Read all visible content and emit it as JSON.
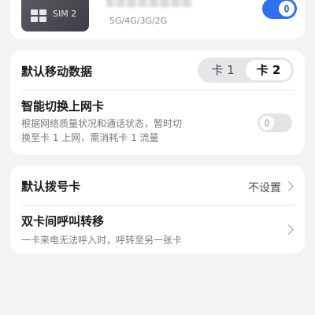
{
  "sim_card": {
    "chip_label": "SIM 2",
    "network_types": "5G/4G/3G/2G",
    "enabled": true
  },
  "default_mobile_data": {
    "title": "默认移动数据",
    "options": [
      "卡 1",
      "卡 2"
    ],
    "selected": "卡 2"
  },
  "smart_switch": {
    "title": "智能切换上网卡",
    "description_line1": "根据网络质量状况和通话状态，暂时切",
    "description_line2": "换至卡 1 上网，需消耗卡 1 流量",
    "enabled": false
  },
  "default_dial": {
    "title": "默认拨号卡",
    "value": "不设置"
  },
  "call_forwarding": {
    "title": "双卡间呼叫转移",
    "description": "一卡来电无法呼入时，呼转至另一张卡"
  },
  "colors": {
    "accent": "#2f6ff0",
    "background": "#f1f3f5",
    "card": "#ffffff"
  }
}
